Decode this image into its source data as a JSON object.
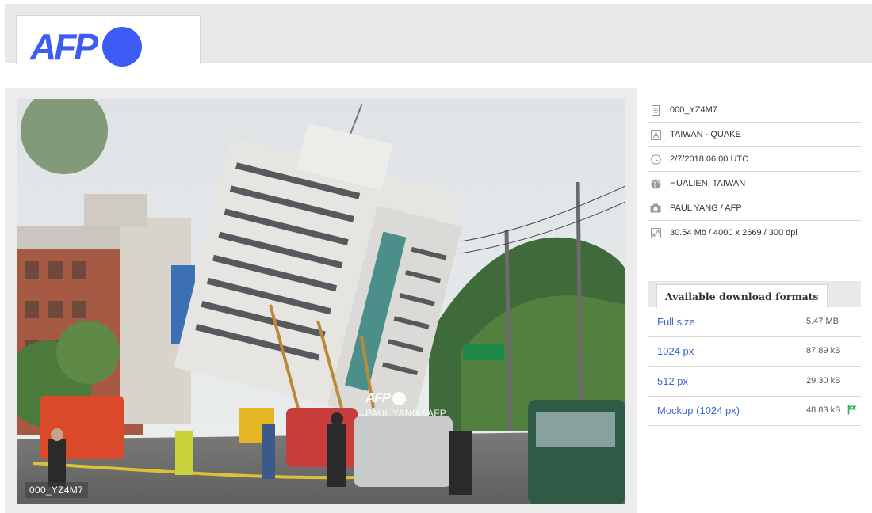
{
  "header": {
    "logo_text": "AFP"
  },
  "photo": {
    "watermark_logo": "AFP",
    "watermark_credit": "PAUL YANG / AFP",
    "id_overlay": "000_YZ4M7"
  },
  "metadata": [
    {
      "icon": "document-icon",
      "text": "000_YZ4M7"
    },
    {
      "icon": "text-a-icon",
      "text": "TAIWAN - QUAKE"
    },
    {
      "icon": "clock-icon",
      "text": "2/7/2018 06:00 UTC"
    },
    {
      "icon": "globe-icon",
      "text": "HUALIEN, TAIWAN"
    },
    {
      "icon": "camera-icon",
      "text": "PAUL YANG / AFP"
    },
    {
      "icon": "resize-icon",
      "text": "30.54 Mb / 4000 x 2669 / 300 dpi"
    }
  ],
  "downloads": {
    "title": "Available download formats",
    "items": [
      {
        "name": "Full size",
        "size": "5.47 MB"
      },
      {
        "name": "1024 px",
        "size": "87.89 kB"
      },
      {
        "name": "512 px",
        "size": "29.30 kB"
      },
      {
        "name": "Mockup (1024 px)",
        "size": "48.83 kB",
        "flag": "green-flag-icon"
      }
    ]
  },
  "colors": {
    "brand": "#3d5cf5",
    "link": "#3b68c7",
    "flag": "#2bb35b"
  }
}
